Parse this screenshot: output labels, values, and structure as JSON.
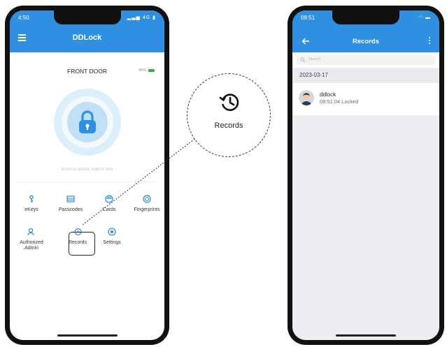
{
  "left_phone": {
    "status": {
      "time": "4:50",
      "right": "4G"
    },
    "app_title": "DDLock",
    "door_name": "FRONT DOOR",
    "battery": "95%",
    "hint": "touch to unlock, hold to lock",
    "features": [
      {
        "label": "eKeys",
        "icon": "ekeys-icon"
      },
      {
        "label": "Passcodes",
        "icon": "passcodes-icon"
      },
      {
        "label": "Cards",
        "icon": "cards-icon"
      },
      {
        "label": "Fingerprints",
        "icon": "fingerprint-icon"
      },
      {
        "label": "Authorized\nAdmin",
        "icon": "admin-icon"
      },
      {
        "label": "Records",
        "icon": "records-icon"
      },
      {
        "label": "Settings",
        "icon": "settings-icon"
      }
    ]
  },
  "callout": {
    "label": "Records",
    "icon": "records-history-icon"
  },
  "right_phone": {
    "status": {
      "time": "08:51"
    },
    "title": "Records",
    "search_placeholder": "Search",
    "date": "2023-03-17",
    "records": [
      {
        "user": "ddlock",
        "detail": "08:51:04 Locked"
      }
    ]
  },
  "colors": {
    "accent": "#2f8fe0",
    "lock": "#2f8fe0",
    "battery": "#27b34a"
  }
}
